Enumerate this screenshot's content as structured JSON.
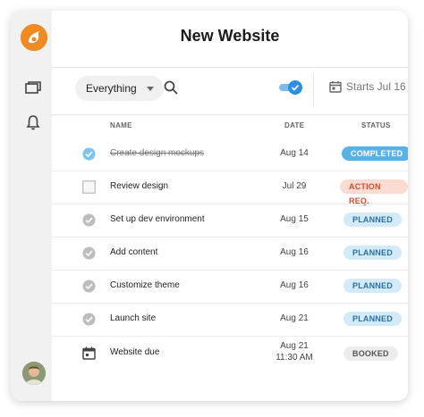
{
  "header": {
    "title": "New Website"
  },
  "toolbar": {
    "filter_label": "Everything",
    "toggle_on": true,
    "starts_label": "Starts Jul 16"
  },
  "table": {
    "columns": [
      "NAME",
      "DATE",
      "STATUS"
    ],
    "rows": [
      {
        "name": "Create design mockups",
        "date": "Aug 14",
        "status": "COMPLETED",
        "icon": "check-filled-icon"
      },
      {
        "name": "Review design",
        "date": "Jul 29",
        "status": "ACTION REQ.",
        "icon": "checkbox-empty-icon"
      },
      {
        "name": "Set up dev environment",
        "date": "Aug 15",
        "status": "PLANNED",
        "icon": "check-circle-icon"
      },
      {
        "name": "Add content",
        "date": "Aug 16",
        "status": "PLANNED",
        "icon": "check-circle-icon"
      },
      {
        "name": "Customize theme",
        "date": "Aug 16",
        "status": "PLANNED",
        "icon": "check-circle-icon"
      },
      {
        "name": "Launch site",
        "date": "Aug 21",
        "status": "PLANNED",
        "icon": "check-circle-icon"
      },
      {
        "name": "Website due",
        "date_line1": "Aug 21",
        "date_line2": "11:30 AM",
        "status": "BOOKED",
        "icon": "calendar-icon"
      }
    ]
  },
  "colors": {
    "accent": "#2d8ee0",
    "completed_bg": "#57b3e6",
    "planned_bg": "#d3ebf8",
    "planned_fg": "#2b6fa3",
    "action_bg": "#fcdcd2",
    "action_fg": "#d0502a",
    "booked_bg": "#ececec",
    "booked_fg": "#555555",
    "brand": "#f28a22"
  }
}
